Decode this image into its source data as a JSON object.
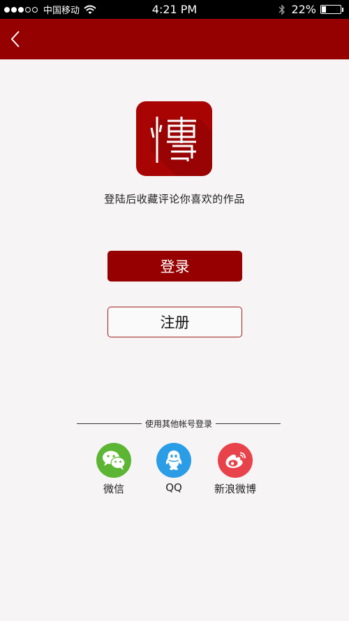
{
  "status_bar": {
    "carrier": "中国移动",
    "time": "4:21 PM",
    "battery_percent": "22%",
    "battery_level": 0.22,
    "signal_bars_filled": 3,
    "signal_bars_total": 5,
    "icons": [
      "wifi-icon",
      "bluetooth-icon",
      "battery-icon"
    ]
  },
  "nav_bar": {
    "back_icon": "chevron-left-icon",
    "color": "#950100"
  },
  "logo": {
    "icon": "bo-character-logo",
    "color": "#a80404"
  },
  "tagline": "登陆后收藏评论你喜欢的作品",
  "buttons": {
    "login": "登录",
    "register": "注册"
  },
  "third_party": {
    "divider_text": "使用其他帐号登录",
    "items": [
      {
        "label": "微信",
        "icon": "wechat-icon",
        "color": "#5cb533"
      },
      {
        "label": "QQ",
        "icon": "qq-icon",
        "color": "#2b9ce6"
      },
      {
        "label": "新浪微博",
        "icon": "weibo-icon",
        "color": "#e8434a"
      }
    ]
  }
}
